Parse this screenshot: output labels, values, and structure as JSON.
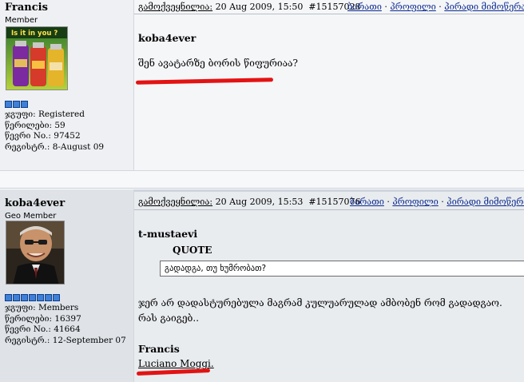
{
  "posts": [
    {
      "username": "Francis",
      "user_title": "Member",
      "avatar_text": "Is it in you ?",
      "group_label": "ჯგუფი:",
      "group_value": "Registered",
      "posts_label": "წერილები:",
      "posts_value": "59",
      "number_label": "წევრი No.:",
      "number_value": "97452",
      "reg_label": "რეგისტრ.:",
      "reg_value": "8-August 09",
      "created_label": "გამოქვეყნილია:",
      "date": "20 Aug 2009, 15:50",
      "post_id": "#15157028",
      "link_report": "ბარათი",
      "link_profile": "პროფილი",
      "link_pm": "პირადი მიმოწერა",
      "quote_author": "koba4ever",
      "message": "შენ ავატარზე ბორის წიფურიაა?"
    },
    {
      "username": "koba4ever",
      "user_title": "Geo Member",
      "group_label": "ჯგუფი:",
      "group_value": "Members",
      "posts_label": "წერილები:",
      "posts_value": "16397",
      "number_label": "წევრი No.:",
      "number_value": "41664",
      "reg_label": "რეგისტრ.:",
      "reg_value": "12-September 07",
      "created_label": "გამოქვეყნილია:",
      "date": "20 Aug 2009, 15:53",
      "post_id": "#15157076",
      "link_report": "ბარათი",
      "link_profile": "პროფილი",
      "link_pm": "პირადი მიმოწერა",
      "quoted_user": "t-mustaevi",
      "quote_label": "QUOTE",
      "quote_text": "გადადგა, თუ ხუმრობათ?",
      "message_line1": "ჯერ არ დადასტურებულა მაგრამ კულუარულად ამბობენ რომ გადადგაო.",
      "message_line2": "რას გაიგებ..",
      "sig_name": "Francis",
      "sig_line": "Luciano Moggi."
    }
  ],
  "colors": {
    "pip_blue": "#3f7fd8",
    "underline_red": "#e31313",
    "link_blue": "#0c2a8f"
  },
  "icons": [
    "rank-pip-icon"
  ]
}
